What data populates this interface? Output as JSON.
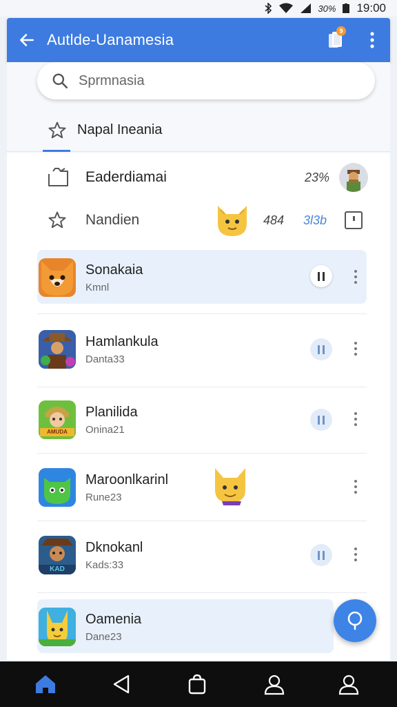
{
  "status_bar": {
    "battery_text": "30%",
    "time": "19:00"
  },
  "app_bar": {
    "title": "Autlde-Uanamesia",
    "notification_count": "9"
  },
  "search": {
    "placeholder": "Sprmnasia"
  },
  "tab": {
    "label": "Napal Ineania"
  },
  "rows": [
    {
      "label": "Eaderdiamai",
      "meta": "23%"
    },
    {
      "label": "Nandien",
      "meta": "484",
      "meta_blue": "3l3b"
    }
  ],
  "apps": [
    {
      "name": "Sonakaia",
      "sub": "Kmnl"
    },
    {
      "name": "Hamlankula",
      "sub": "Danta33"
    },
    {
      "name": "Planilida",
      "sub": "Onina21",
      "badge": "AMUDA"
    },
    {
      "name": "Maroonlkarinl",
      "sub": "Rune23"
    },
    {
      "name": "Dknokanl",
      "sub": "Kads:33",
      "badge": "KAD"
    },
    {
      "name": "Oamenia",
      "sub": "Dane23"
    }
  ],
  "colors": {
    "primary": "#3d7be0",
    "fab": "#3d84e6",
    "nav_bg": "#0e0e0e",
    "highlight": "#e8f1fb"
  },
  "icons": {
    "back": "arrow-left-icon",
    "devices": "devices-icon",
    "more": "more-vert-icon",
    "search": "search-icon",
    "star": "star-icon",
    "folder": "folder-icon",
    "fab": "chat-icon"
  }
}
